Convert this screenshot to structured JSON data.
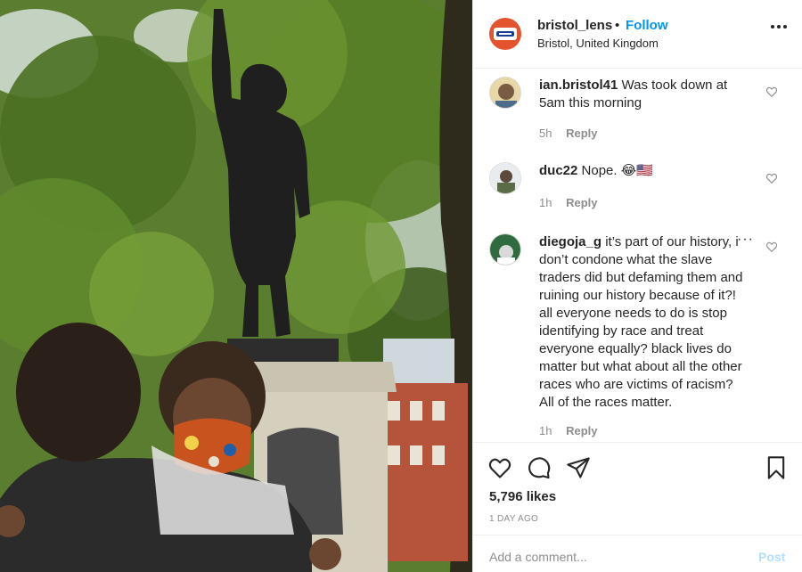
{
  "post": {
    "username": "bristol_lens",
    "separator": "•",
    "follow_label": "Follow",
    "location": "Bristol, United Kingdom",
    "avatar_badge": "Bristol Lens"
  },
  "comments": [
    {
      "username": "ian.bristol41",
      "text": "Was took down at 5am this morning",
      "time": "5h",
      "reply_label": "Reply"
    },
    {
      "username": "duc22",
      "text": "Nope. 😂🇺🇸",
      "time": "1h",
      "reply_label": "Reply"
    },
    {
      "username": "diegoja_g",
      "text": "it’s part of our history, i don’t condone what the slave traders did but defaming them and ruining our history because of it?! all everyone needs to do is stop identifying by race and treat everyone equally? black lives do matter but what about all the other races who are victims of racism? All of the races matter.",
      "time": "1h",
      "reply_label": "Reply"
    }
  ],
  "actions": {
    "icons": [
      "heart-icon",
      "comment-icon",
      "share-icon",
      "bookmark-icon"
    ]
  },
  "likes": "5,796 likes",
  "date": "1 DAY AGO",
  "add_comment": {
    "placeholder": "Add a comment...",
    "post_label": "Post"
  },
  "colors": {
    "accent": "#0095f6",
    "post_disabled": "#b2dffc",
    "muted": "#8e8e8e",
    "text": "#262626",
    "avatar_bg": "#e3532e"
  }
}
